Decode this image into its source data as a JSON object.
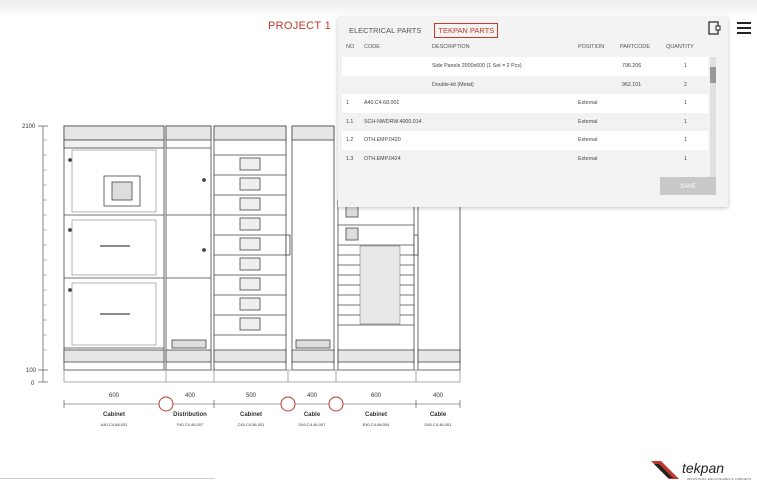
{
  "header": {
    "project_title": "PROJECT 1",
    "menu_icon": "hamburger-menu-icon",
    "doc_icon": "document-export-icon"
  },
  "parts_panel": {
    "tabs": [
      {
        "label": "ELECTRICAL PARTS",
        "active": false
      },
      {
        "label": "TEKPAN PARTS",
        "active": true
      }
    ],
    "columns": {
      "no": "NO",
      "code": "CODE",
      "description": "DESCRIPTION",
      "position": "POSITION",
      "partcode": "PARTCODE",
      "quantity": "QUANTITY"
    },
    "rows": [
      {
        "no": "",
        "code": "",
        "description": "Side Panels 2000x600 (1 Set = 2 Pcs)",
        "position": "",
        "partcode": "796.206",
        "quantity": "1"
      },
      {
        "no": "",
        "code": "",
        "description": "Double-kit (Metal)",
        "position": "",
        "partcode": "962.101",
        "quantity": "2"
      },
      {
        "no": "1",
        "code": "A40.C4.68.001",
        "description": "",
        "position": "External",
        "partcode": "",
        "quantity": "1"
      },
      {
        "no": "1.1",
        "code": "SCH-NWDRW.4000.014",
        "description": "",
        "position": "External",
        "partcode": "",
        "quantity": "1"
      },
      {
        "no": "1.2",
        "code": "OTH.EMP.0420",
        "description": "",
        "position": "External",
        "partcode": "",
        "quantity": "1"
      },
      {
        "no": "1.3",
        "code": "OTH.EMP.0424",
        "description": "",
        "position": "External",
        "partcode": "",
        "quantity": "1"
      }
    ],
    "save_label": "SAVE"
  },
  "drawing": {
    "dim_top": "2100",
    "dim_100": "100",
    "dim_0": "0",
    "cabinets": [
      {
        "width": "600",
        "type": "Cabinet",
        "code": "A40.C4.68.001"
      },
      {
        "width": "400",
        "type": "Distribution",
        "code": "F40.C4.46.007"
      },
      {
        "width": "500",
        "type": "Cabinet",
        "code": "C40.C4.56.001"
      },
      {
        "width": "400",
        "type": "Cable",
        "code": "D40.C4.46.007"
      },
      {
        "width": "600",
        "type": "Cabinet",
        "code": "E40.C4.68.004"
      },
      {
        "width": "400",
        "type": "Cable",
        "code": "D40.C4.46.001"
      }
    ]
  },
  "logo": {
    "name": "tekpan",
    "tagline": "INDUSTRIAL ENCLOSURES & CABINETS"
  }
}
